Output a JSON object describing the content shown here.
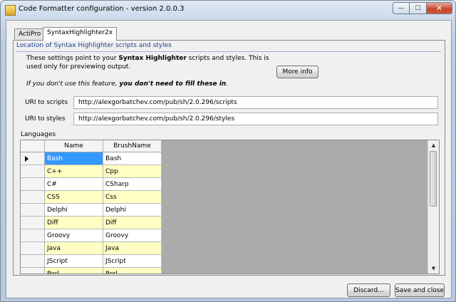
{
  "window": {
    "title": "Code Formatter configuration - version 2.0.0.3",
    "minimize_glyph": "—",
    "maximize_glyph": "☐",
    "close_glyph": "✕"
  },
  "tabs": [
    {
      "label": "ActiPro",
      "selected": false
    },
    {
      "label": "SyntaxHighlighter2x",
      "selected": true
    }
  ],
  "location_group": {
    "title": "Location of Syntax Highlighter scripts and styles",
    "desc_line1_pre": "These settings point to your ",
    "desc_line1_bold": "Syntax Highlighter",
    "desc_line1_post": " scripts and styles.  This is used only for previewing output.",
    "desc_line2_pre": "If you don't use this feature, ",
    "desc_line2_bold": "you don't need to fill these in",
    "desc_line2_post": ".",
    "more_info_label": "More info"
  },
  "fields": {
    "scripts_label": "URI to scripts",
    "scripts_value": "http://alexgorbatchev.com/pub/sh/2.0.296/scripts",
    "styles_label": "URI to styles",
    "styles_value": "http://alexgorbatchev.com/pub/sh/2.0.296/styles"
  },
  "languages": {
    "label": "Languages",
    "columns": [
      "Name",
      "BrushName"
    ],
    "rows": [
      {
        "name": "Bash",
        "brush": "Bash"
      },
      {
        "name": "C++",
        "brush": "Cpp"
      },
      {
        "name": "C#",
        "brush": "CSharp"
      },
      {
        "name": "CSS",
        "brush": "Css"
      },
      {
        "name": "Delphi",
        "brush": "Delphi"
      },
      {
        "name": "Diff",
        "brush": "Diff"
      },
      {
        "name": "Groovy",
        "brush": "Groovy"
      },
      {
        "name": "Java",
        "brush": "Java"
      },
      {
        "name": "JScript",
        "brush": "JScript"
      },
      {
        "name": "Perl",
        "brush": "Perl"
      }
    ],
    "selected_row": 0
  },
  "footer": {
    "discard_label": "Discard...",
    "save_label": "Save and close"
  },
  "colors": {
    "selection": "#3399ff",
    "alt_row": "#ffffc4",
    "group_title": "#1a3f8c"
  }
}
